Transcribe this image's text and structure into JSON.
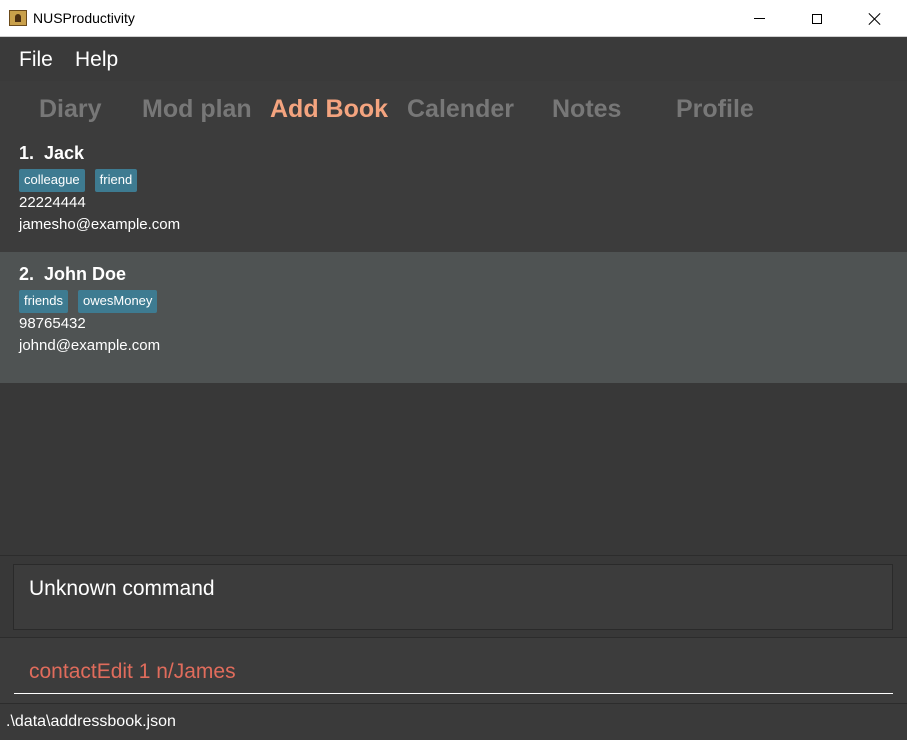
{
  "window": {
    "title": "NUSProductivity",
    "controls": [
      "minimize-icon",
      "maximize-icon",
      "close-icon"
    ]
  },
  "menu": {
    "items": [
      "File",
      "Help"
    ]
  },
  "tabs": [
    {
      "label": "Diary",
      "active": false
    },
    {
      "label": "Mod plan",
      "active": false
    },
    {
      "label": "Add Book",
      "active": true
    },
    {
      "label": "Calender",
      "active": false
    },
    {
      "label": "Notes",
      "active": false
    },
    {
      "label": "Profile",
      "active": false
    }
  ],
  "contacts": [
    {
      "name": "1.  Jack",
      "tags": [
        "colleague",
        "friend"
      ],
      "phone": "22224444",
      "email": "jamesho@example.com",
      "selected": false
    },
    {
      "name": "2.  John Doe",
      "tags": [
        "friends",
        "owesMoney"
      ],
      "phone": "98765432",
      "email": "johnd@example.com",
      "selected": true
    }
  ],
  "result": {
    "message": "Unknown command"
  },
  "command": {
    "value": "contactEdit 1 n/James"
  },
  "status": {
    "path": ".\\data\\addressbook.json"
  },
  "colors": {
    "background": "#3c3c3c",
    "active_tab": "#f4a47f",
    "inactive_tab": "#777777",
    "tag": "#3e7b91",
    "selected_card": "#4f5353",
    "command_text": "#e06c5c"
  }
}
